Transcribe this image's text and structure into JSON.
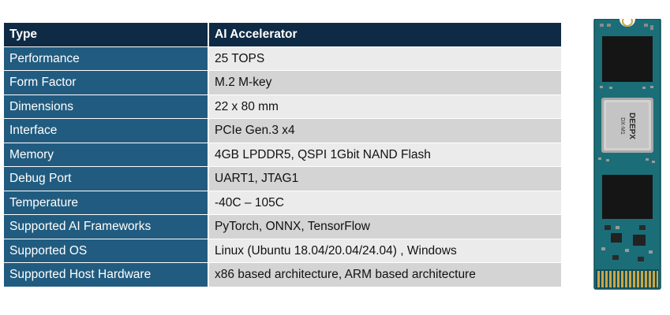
{
  "table": {
    "header": {
      "key": "Type",
      "value": "AI Accelerator"
    },
    "rows": [
      {
        "key": "Performance",
        "value": "25 TOPS"
      },
      {
        "key": "Form Factor",
        "value": "M.2 M-key"
      },
      {
        "key": "Dimensions",
        "value": "22 x 80 mm"
      },
      {
        "key": "Interface",
        "value": "PCIe Gen.3 x4"
      },
      {
        "key": "Memory",
        "value": "4GB LPDDR5, QSPI 1Gbit NAND Flash"
      },
      {
        "key": "Debug Port",
        "value": "UART1, JTAG1"
      },
      {
        "key": "Temperature",
        "value": "-40C – 105C"
      },
      {
        "key": "Supported AI Frameworks",
        "value": "PyTorch, ONNX, TensorFlow"
      },
      {
        "key": "Supported OS",
        "value": "Linux (Ubuntu 18.04/20.04/24.04) , Windows"
      },
      {
        "key": "Supported Host Hardware",
        "value": "x86 based architecture, ARM based architecture"
      }
    ]
  },
  "module_image": {
    "chip_brand": "DEEPX",
    "chip_model": "DX-M1",
    "colors": {
      "pcb": "#1b6e78",
      "chip": "#c8c8c8",
      "memory": "#151515",
      "gold": "#c9a64a"
    }
  }
}
